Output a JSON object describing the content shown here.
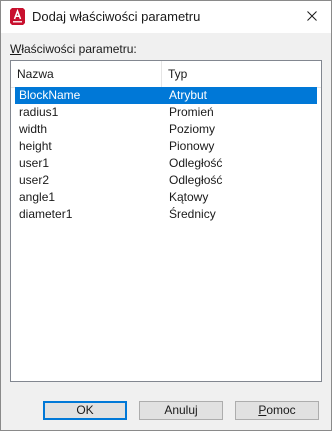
{
  "window": {
    "title": "Dodaj właściwości parametru",
    "icon": "autocad-app-icon",
    "close_icon": "close-icon"
  },
  "group": {
    "label_prefix": "",
    "label_mnemonic": "W",
    "label_rest": "łaściwości parametru:"
  },
  "list": {
    "columns": [
      "Nazwa",
      "Typ"
    ],
    "rows": [
      {
        "name": "BlockName",
        "type": "Atrybut",
        "selected": true
      },
      {
        "name": "radius1",
        "type": "Promień",
        "selected": false
      },
      {
        "name": "width",
        "type": "Poziomy",
        "selected": false
      },
      {
        "name": "height",
        "type": "Pionowy",
        "selected": false
      },
      {
        "name": "user1",
        "type": "Odległość",
        "selected": false
      },
      {
        "name": "user2",
        "type": "Odległość",
        "selected": false
      },
      {
        "name": "angle1",
        "type": "Kątowy",
        "selected": false
      },
      {
        "name": "diameter1",
        "type": "Średnicy",
        "selected": false
      }
    ]
  },
  "buttons": {
    "ok": "OK",
    "cancel": "Anuluj",
    "help_mnemonic": "P",
    "help_rest": "omoc"
  },
  "colors": {
    "selection": "#0078d7",
    "app_icon": "#c8102e"
  }
}
